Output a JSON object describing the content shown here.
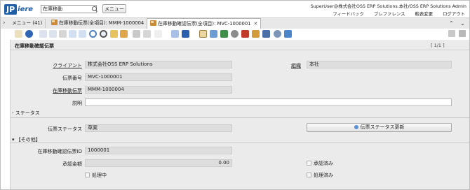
{
  "header": {
    "logo_prefix": "JP",
    "logo_rest": "iere",
    "search_value": "在庫移動",
    "menu_button": "メニュー",
    "user_info": "SuperUser@株式会社OSS ERP Solutions.本社/OSS ERP Solutions Admin",
    "links": [
      "フィードバック",
      "プレファレンス",
      "較表変更",
      "ログアウト"
    ]
  },
  "tabs": [
    {
      "label": "メニュー (41)"
    },
    {
      "label": "在庫移動伝票(全項目): MMM-1000004"
    },
    {
      "label": "在庫移動確認伝票(全項目): MVC-1000001"
    }
  ],
  "form": {
    "title": "在庫移動確認伝票",
    "pager": "[ 1/1 ]",
    "client_label": "クライアント",
    "client_value": "株式会社OSS ERP Solutions",
    "org_label": "組織",
    "org_value": "本社",
    "docno_label": "伝票番号",
    "docno_value": "MVC-1000001",
    "movement_label": "在庫移動伝票",
    "movement_value": "MMM-1000004",
    "desc_label": "説明",
    "desc_value": "",
    "status_section": "- ステータス",
    "docstatus_label": "伝票ステータス",
    "docstatus_value": "草案",
    "docstatus_button": "伝票ステータス更新",
    "other_section": "【その他】",
    "confirm_id_label": "在庫移動確認伝票ID",
    "confirm_id_value": "1000001",
    "approval_amount_label": "承認金額",
    "approval_amount_value": "0.00",
    "approved_label": "承認済み",
    "processing_label": "処理中",
    "processed_label": "処理済み"
  },
  "colors": {
    "brand": "#1f5fa8",
    "panel_bg": "#ebebeb",
    "field_bg": "#dedede"
  }
}
